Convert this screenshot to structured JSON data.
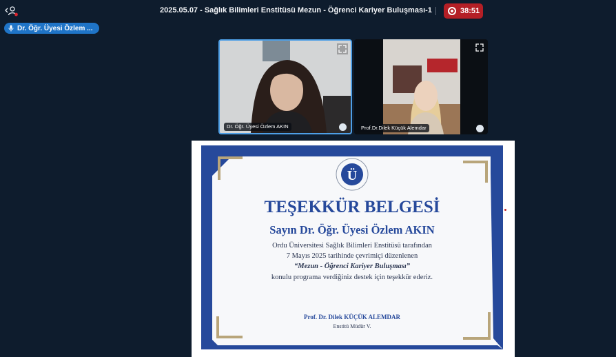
{
  "meeting": {
    "title": "2025.05.07 - Sağlık Bilimleri Enstitüsü Mezun - Öğrenci Kariyer Buluşması-1",
    "recording_time": "38:51"
  },
  "active_speaker": {
    "label": "Dr. Öğr. Üyesi Özlem ..."
  },
  "tiles": [
    {
      "name": "Dr. Öğr. Üyesi Özlem AKIN"
    },
    {
      "name": "Prof.Dr.Dilek Küçük Alemdar"
    }
  ],
  "certificate": {
    "logo_text": "ORDU ÜNİVERSİTESİ",
    "title": "TEŞEKKÜR BELGESİ",
    "recipient": "Sayın Dr. Öğr. Üyesi Özlem AKIN",
    "line1": "Ordu Üniversitesi Sağlık Bilimleri Enstitüsü tarafından",
    "line2": "7 Mayıs 2025 tarihinde çevrimiçi düzenlenen",
    "line3": "“Mezun - Öğrenci Kariyer Buluşması”",
    "line4": "konulu programa verdiğiniz destek için teşekkür ederiz.",
    "signer": "Prof. Dr. Dilek KÜÇÜK ALEMDAR",
    "signer_title": "Enstitü Müdür V."
  },
  "colors": {
    "background": "#0e1c2d",
    "recording": "#b41f26",
    "speaker_pill": "#1f74c7",
    "certificate_blue": "#26499b",
    "certificate_gold": "#b8a57a"
  }
}
